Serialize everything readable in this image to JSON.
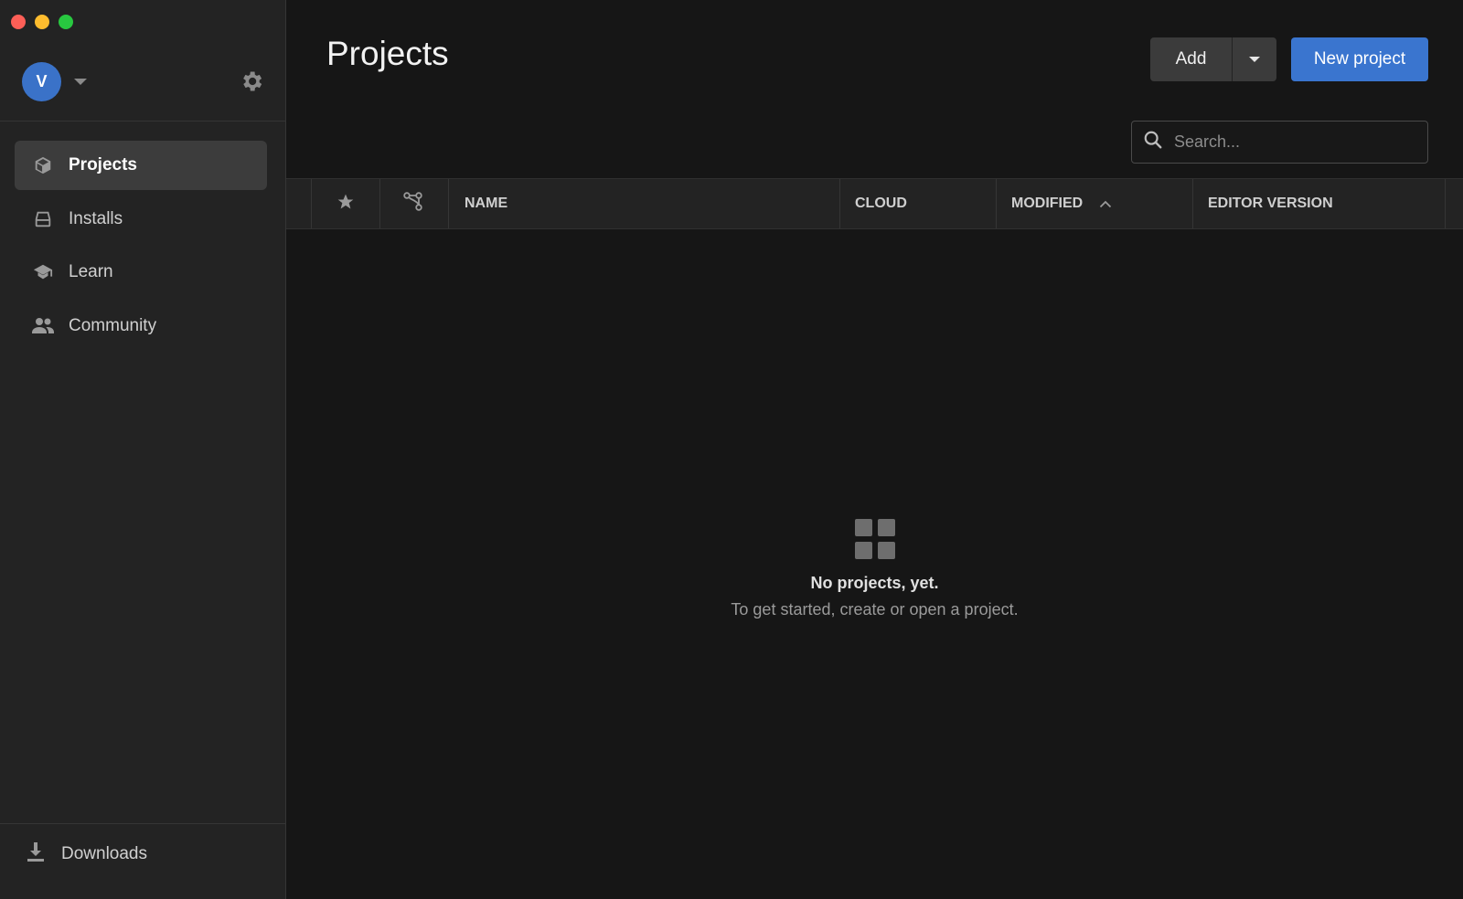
{
  "account": {
    "initial": "V"
  },
  "nav": {
    "items": [
      {
        "label": "Projects",
        "icon": "cube-icon"
      },
      {
        "label": "Installs",
        "icon": "drive-icon"
      },
      {
        "label": "Learn",
        "icon": "graduation-cap-icon"
      },
      {
        "label": "Community",
        "icon": "people-icon"
      }
    ]
  },
  "footer": {
    "downloads_label": "Downloads"
  },
  "header": {
    "title": "Projects",
    "add_label": "Add",
    "new_project_label": "New project"
  },
  "search": {
    "placeholder": "Search..."
  },
  "table": {
    "columns": {
      "name": "NAME",
      "cloud": "CLOUD",
      "modified": "MODIFIED",
      "editor_version": "EDITOR VERSION"
    }
  },
  "empty_state": {
    "title": "No projects, yet.",
    "subtitle": "To get started, create or open a project."
  },
  "colors": {
    "accent": "#3a75cf",
    "sidebar": "#232323",
    "background": "#161616"
  }
}
